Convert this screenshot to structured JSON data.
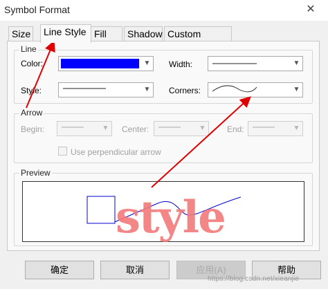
{
  "window": {
    "title": "Symbol Format",
    "close_glyph": "✕"
  },
  "tabs": [
    {
      "label": "Size"
    },
    {
      "label": "Line Style"
    },
    {
      "label": "Fill"
    },
    {
      "label": "Shadow"
    },
    {
      "label": "Custom Shape"
    }
  ],
  "line_group": {
    "title": "Line",
    "color_label": "Color:",
    "color_value": "#0000ff",
    "width_label": "Width:",
    "style_label": "Style:",
    "corners_label": "Corners:"
  },
  "arrow_group": {
    "title": "Arrow",
    "begin_label": "Begin:",
    "center_label": "Center:",
    "end_label": "End:",
    "perpendicular_label": "Use perpendicular arrow",
    "perpendicular_checked": false
  },
  "preview_group": {
    "title": "Preview",
    "annotation_text": "style",
    "line_color": "#0000ff",
    "annotation_color": "#f27a7a"
  },
  "buttons": {
    "ok": "确定",
    "cancel": "取消",
    "apply": "应用(A)",
    "help": "帮助"
  },
  "annotation": {
    "arrow_color": "#e00000"
  },
  "watermark": "https://blog.csdn.net/xieanjie"
}
